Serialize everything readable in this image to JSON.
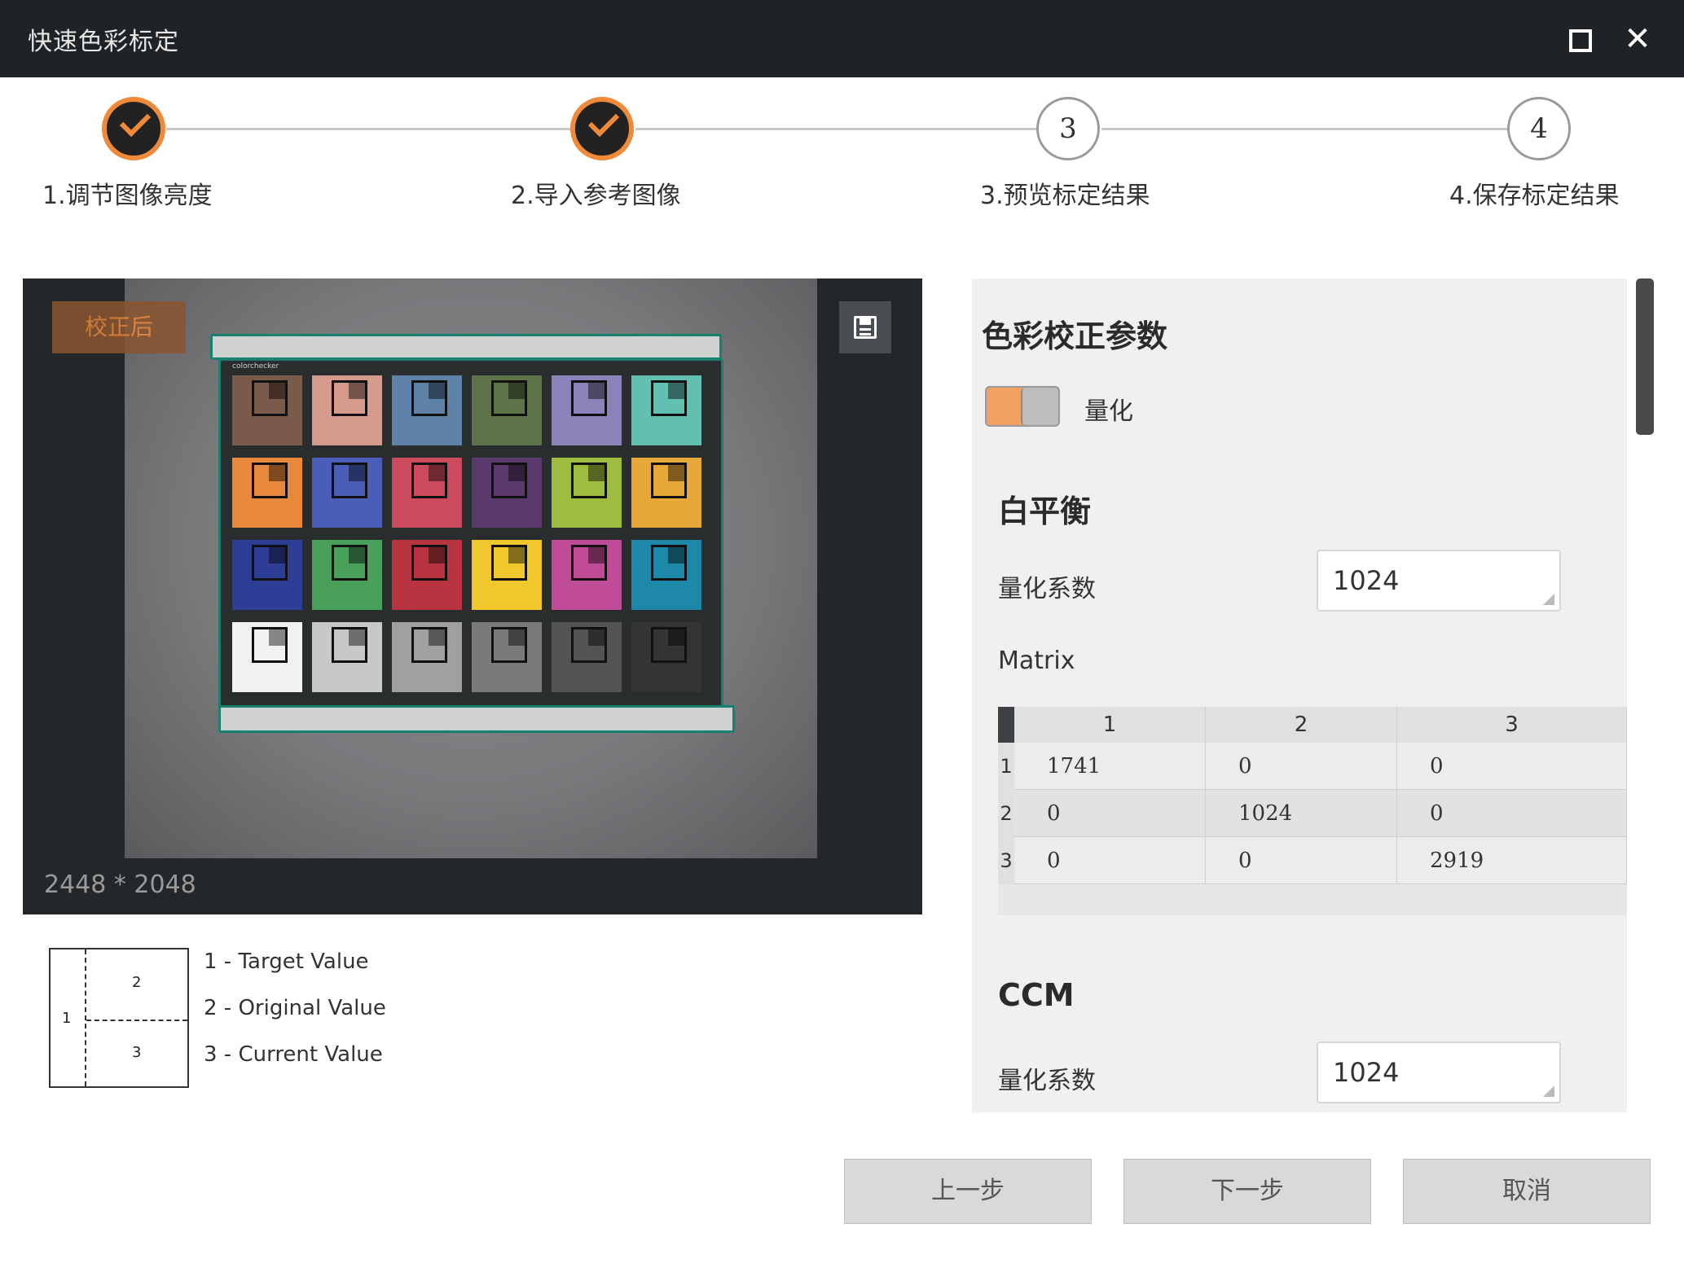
{
  "window": {
    "title": "快速色彩标定"
  },
  "steps": [
    {
      "label": "1.调节图像亮度",
      "state": "done"
    },
    {
      "label": "2.导入参考图像",
      "state": "done"
    },
    {
      "label": "3.预览标定结果",
      "number": "3",
      "state": "todo"
    },
    {
      "label": "4.保存标定结果",
      "number": "4",
      "state": "todo"
    }
  ],
  "preview": {
    "badge": "校正后",
    "resolution": "2448 * 2048",
    "save_icon": "save-icon"
  },
  "legend": {
    "box_numbers": [
      "1",
      "2",
      "3"
    ],
    "items": [
      "1 - Target Value",
      "2 - Original Value",
      "3 - Current Value"
    ]
  },
  "params": {
    "title": "色彩校正参数",
    "toggle_label": "量化",
    "white_balance": {
      "title": "白平衡",
      "quant_label": "量化系数",
      "quant_value": "1024",
      "matrix_label": "Matrix",
      "col_headers": [
        "1",
        "2",
        "3"
      ],
      "row_headers": [
        "1",
        "2",
        "3"
      ],
      "rows": [
        [
          "1741",
          "0",
          "0"
        ],
        [
          "0",
          "1024",
          "0"
        ],
        [
          "0",
          "0",
          "2919"
        ]
      ]
    },
    "ccm": {
      "title": "CCM",
      "quant_label": "量化系数",
      "quant_value": "1024"
    }
  },
  "buttons": {
    "prev": "上一步",
    "next": "下一步",
    "cancel": "取消"
  },
  "colors": {
    "accent": "#f08a3b",
    "titlebar": "#1f2326"
  }
}
